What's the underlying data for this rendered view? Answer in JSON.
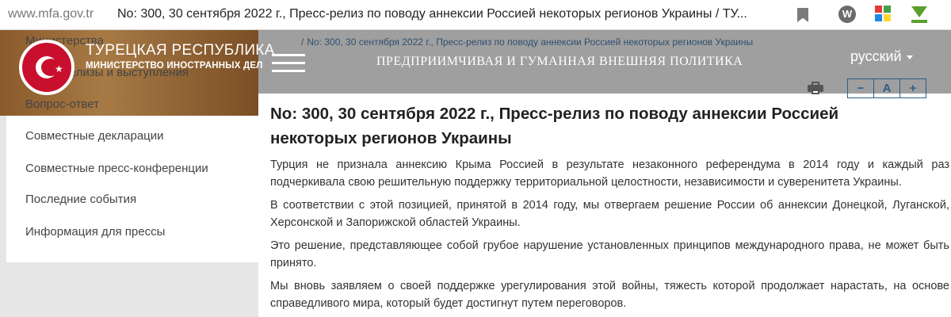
{
  "browser": {
    "url": "www.mfa.gov.tr",
    "tab_title": "No: 300, 30 сентября 2022 г., Пресс-релиз по поводу аннексии Россией некоторых регионов Украины / ТУ..."
  },
  "logo": {
    "title": "ТУРЕЦКАЯ РЕСПУБЛИКА",
    "subtitle": "МИНИСТЕРСТВО ИНОСТРАННЫХ ДЕЛ"
  },
  "header": {
    "tagline": "ПРЕДПРИИМЧИВАЯ И ГУМАННАЯ ВНЕШНЯЯ ПОЛИТИКА",
    "language": "русский"
  },
  "breadcrumbs": {
    "current": "No: 300, 30 сентября 2022 г., Пресс-релиз по поводу аннексии Россией некоторых регионов Украины"
  },
  "sidebar": {
    "items": [
      {
        "label": "Министерства"
      },
      {
        "label": "Пресс-релизы и выступления"
      },
      {
        "label": "Вопрос-ответ"
      },
      {
        "label": "Совместные декларации"
      },
      {
        "label": "Совместные пресс-конференции"
      },
      {
        "label": "Последние события"
      },
      {
        "label": "Информация для прессы"
      }
    ]
  },
  "font_controls": {
    "decrease": "−",
    "reset": "A",
    "increase": "+"
  },
  "article": {
    "title": "No: 300, 30 сентября 2022 г., Пресс-релиз по поводу аннексии Россией некоторых регионов Украины",
    "paragraphs": [
      "Турция не признала аннексию Крыма Россией в результате незаконного референдума в 2014 году и каждый раз подчеркивала свою решительную поддержку территориальной целостности, независимости и суверенитета Украины.",
      "В соответствии с этой позицией, принятой в 2014 году, мы отвергаем решение России об аннексии Донецкой, Луганской, Херсонской и Запорижской областей Украины.",
      "Это решение, представляющее собой грубое нарушение установленных принципов международного права, не может быть принято.",
      "Мы вновь заявляем о своей поддержке урегулирования этой войны, тяжесть которой продолжает нарастать, на основе справедливого мира, который будет достигнут путем переговоров."
    ]
  }
}
